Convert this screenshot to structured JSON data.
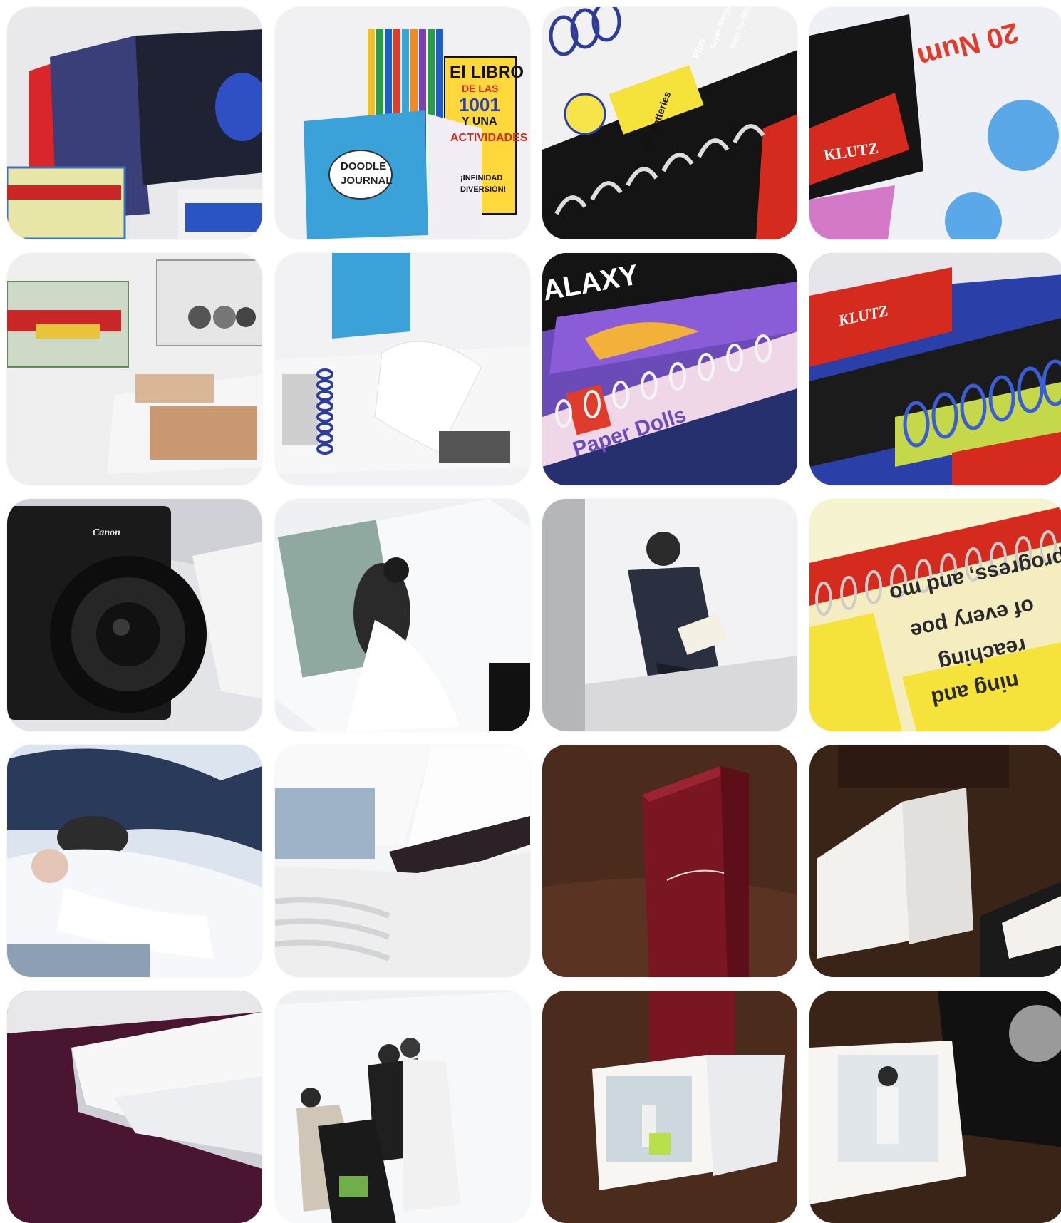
{
  "tiles": [
    {
      "id": "r1c1",
      "texts": []
    },
    {
      "id": "r1c2",
      "texts": [
        "El LIBRO",
        "DE LAS",
        "1001",
        "Y UNA",
        "ACTIVIDADES",
        "¡INFINIDAD",
        "DIVERSIÓN!",
        "DOODLE",
        "JOURNAL"
      ]
    },
    {
      "id": "r1c3",
      "texts": [
        "No-Batteries",
        "Plus",
        "Super-Simple",
        "Step-by-Step"
      ]
    },
    {
      "id": "r1c4",
      "texts": [
        "KLUTZ",
        "20 Num"
      ]
    },
    {
      "id": "r2c1",
      "texts": []
    },
    {
      "id": "r2c2",
      "texts": []
    },
    {
      "id": "r2c3",
      "texts": [
        "ALAXY",
        "Paper Dolls"
      ]
    },
    {
      "id": "r2c4",
      "texts": [
        "KLUTZ"
      ]
    },
    {
      "id": "r3c1",
      "texts": [
        "Canon"
      ]
    },
    {
      "id": "r3c2",
      "texts": []
    },
    {
      "id": "r3c3",
      "texts": []
    },
    {
      "id": "r3c4",
      "texts": [
        "progress, and mo",
        "of every poe",
        "reaching",
        "ning and"
      ]
    },
    {
      "id": "r4c1",
      "texts": []
    },
    {
      "id": "r4c2",
      "texts": []
    },
    {
      "id": "r4c3",
      "texts": []
    },
    {
      "id": "r4c4",
      "texts": []
    },
    {
      "id": "r5c1",
      "texts": []
    },
    {
      "id": "r5c2",
      "texts": []
    },
    {
      "id": "r5c3",
      "texts": []
    },
    {
      "id": "r5c4",
      "texts": []
    }
  ],
  "colors": {
    "red": "#d52b1e",
    "blue": "#2a3fa8",
    "purple": "#6b4bb8",
    "yellow": "#f5e23a",
    "brown": "#4a2b1c",
    "maroon": "#7a1622",
    "plum": "#4a1530"
  }
}
